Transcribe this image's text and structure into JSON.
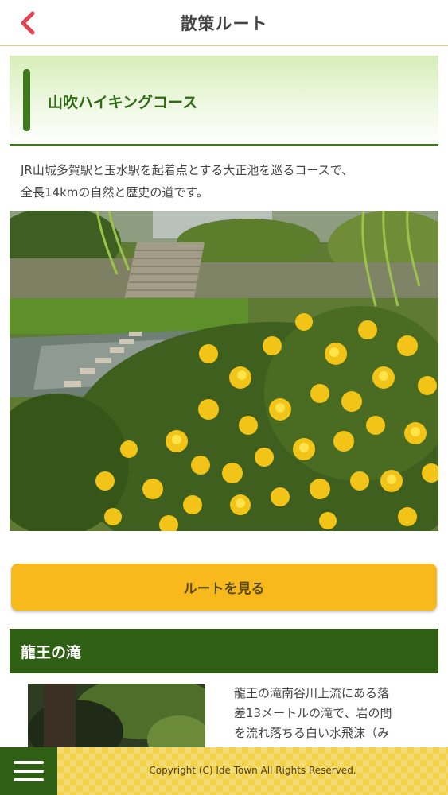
{
  "header": {
    "title": "散策ルート",
    "back_icon": "chevron-left-icon",
    "back_color": "#e0434f"
  },
  "course": {
    "title": "山吹ハイキングコース",
    "description_lines": [
      "JR山城多賀駅と玉水駅を起着点とする大正池を巡るコースで、",
      "全長14kmの自然と歴史の道です。"
    ],
    "accent_color": "#3f7a1e"
  },
  "route_button": {
    "label": "ルートを見る",
    "color": "#f7b91b"
  },
  "spot": {
    "title": "龍王の滝",
    "description_lines": [
      "龍王の滝南谷川上流にある落",
      "差13メートルの滝で、岩の間",
      "を流れ落ちる白い水飛沫（み"
    ]
  },
  "footer": {
    "menu_icon": "hamburger-menu-icon",
    "copyright": "Copyright (C) Ide Town All Rights Reserved."
  }
}
